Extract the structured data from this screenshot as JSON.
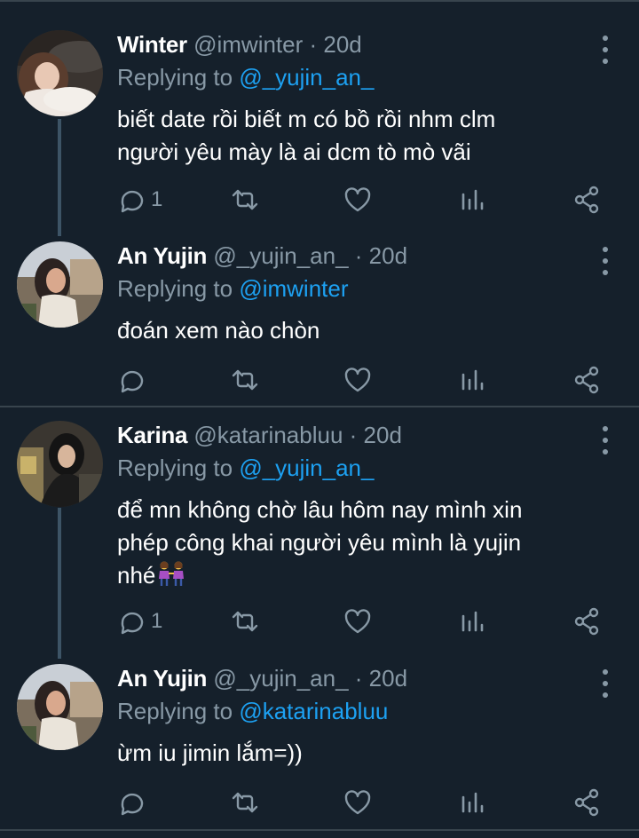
{
  "tweets": [
    {
      "name": "Winter",
      "handle": "@imwinter",
      "time": "20d",
      "replying_prefix": "Replying to ",
      "replying_to": "@_yujin_an_",
      "lines": [
        "biết date rồi biết m có bồ rồi nhm clm",
        "người yêu mày là ai dcm tò mò vãi"
      ],
      "reply_count": "1",
      "avatar_icon": "avatar-winter"
    },
    {
      "name": "An Yujin",
      "handle": "@_yujin_an_",
      "time": "20d",
      "replying_prefix": "Replying to ",
      "replying_to": "@imwinter",
      "lines": [
        "đoán xem nào chòn"
      ],
      "reply_count": "",
      "avatar_icon": "avatar-yujin"
    },
    {
      "name": "Karina",
      "handle": "@katarinabluu",
      "time": "20d",
      "replying_prefix": "Replying to ",
      "replying_to": "@_yujin_an_",
      "lines": [
        "để mn không chờ lâu hôm nay mình xin",
        "phép công khai người yêu mình là yujin",
        "nhé"
      ],
      "emoji": "women-holding-hands-emoji",
      "reply_count": "1",
      "avatar_icon": "avatar-karina"
    },
    {
      "name": "An Yujin",
      "handle": "@_yujin_an_",
      "time": "20d",
      "replying_prefix": "Replying to ",
      "replying_to": "@katarinabluu",
      "lines": [
        "ừm iu jimin lắm=))"
      ],
      "reply_count": "",
      "avatar_icon": "avatar-yujin"
    }
  ],
  "separator": " · ",
  "colors": {
    "background": "#15202b",
    "secondary_text": "#8899a6",
    "link": "#1da1f2",
    "divider": "#38444d"
  }
}
